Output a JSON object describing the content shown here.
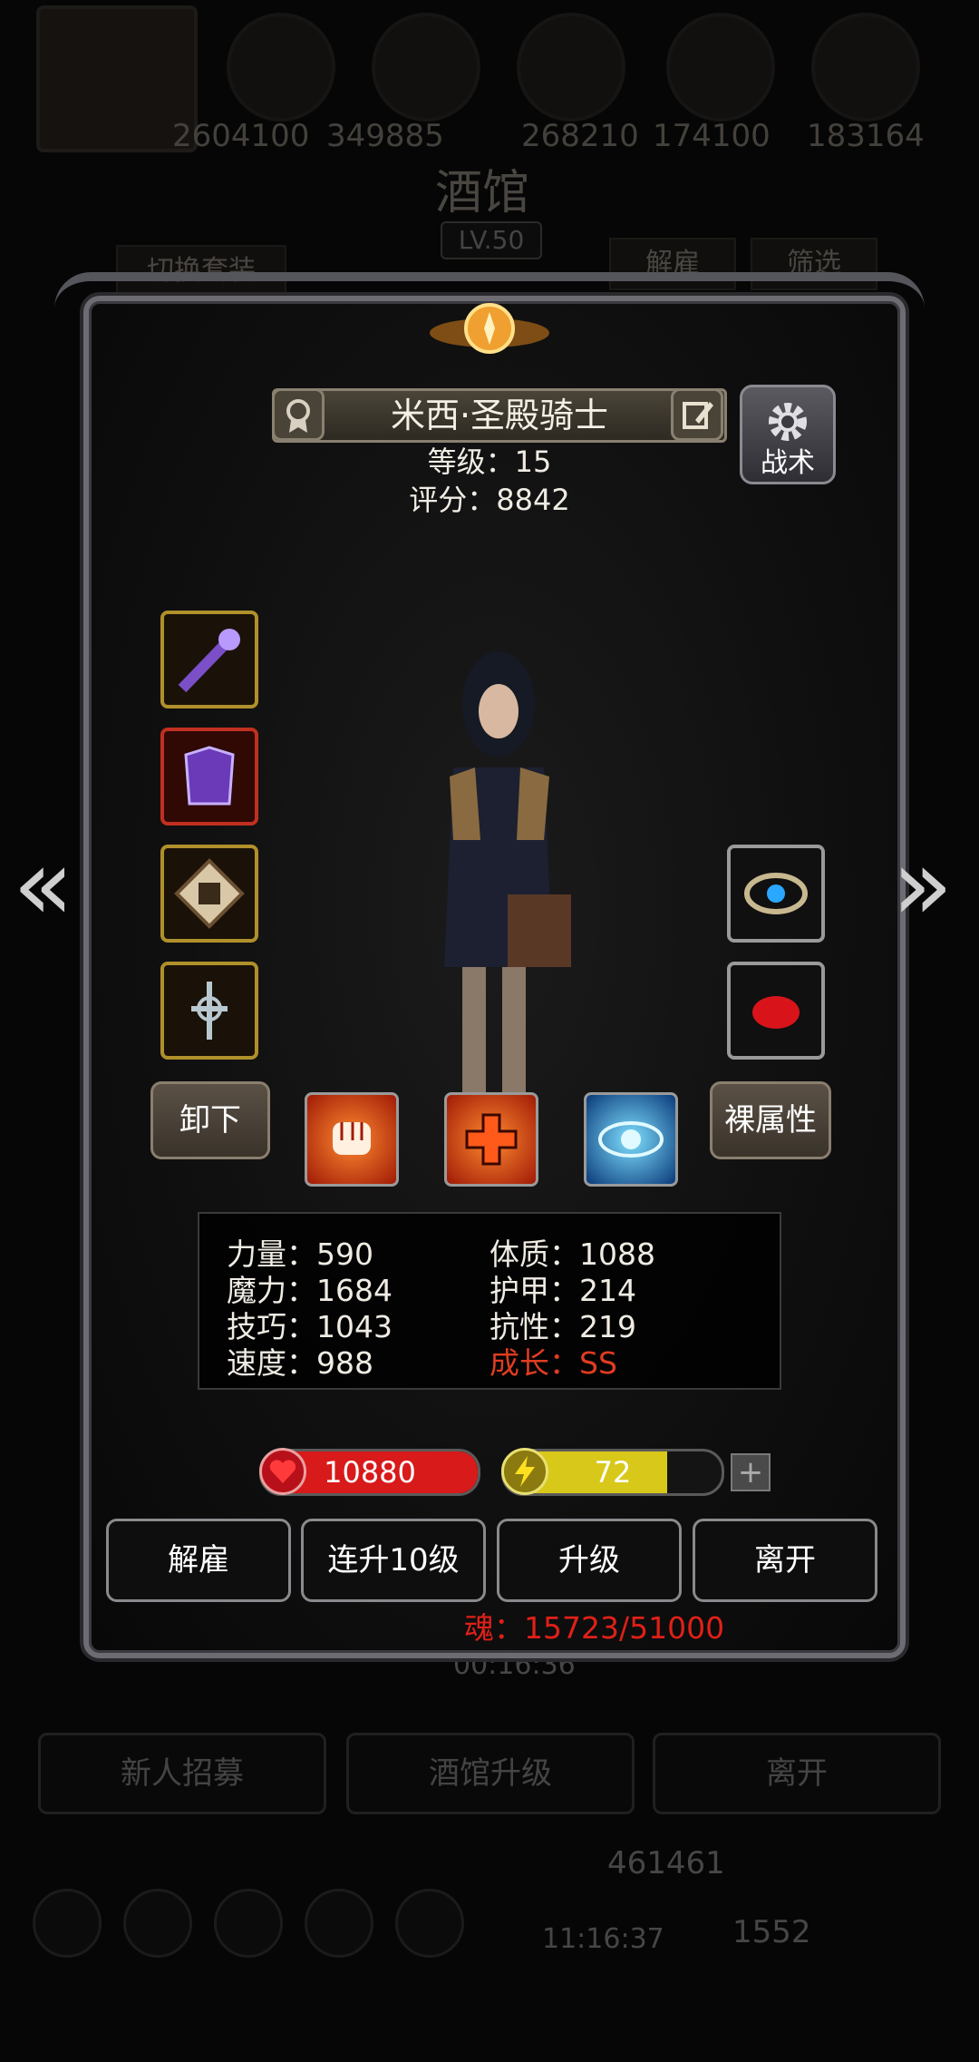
{
  "background": {
    "resources": [
      "2604100",
      "349885",
      "268210",
      "174100",
      "183164"
    ],
    "title": "酒馆",
    "level": "LV.50",
    "switch_outfit_label": "切换套装",
    "dismiss_label": "解雇",
    "filter_label": "筛选",
    "timer": "00:16:36",
    "bottom_buttons": [
      "新人招募",
      "酒馆升级",
      "离开"
    ],
    "gold": "461461",
    "gems": "1552",
    "clock": "11:16:37"
  },
  "hero": {
    "name": "米西·圣殿骑士",
    "level_line": "等级：15",
    "score_line": "评分：8842",
    "tactics_label": "战术"
  },
  "buttons": {
    "unequip": "卸下",
    "bare_attributes": "裸属性"
  },
  "stats": {
    "strength": "力量：590",
    "magic": "魔力：1684",
    "skill": "技巧：1043",
    "speed": "速度：988",
    "constitution": "体质：1088",
    "armor": "护甲：214",
    "resistance": "抗性：219",
    "growth": "成长：SS"
  },
  "bars": {
    "hp": "10880",
    "energy": "72",
    "energy_fraction": 0.75,
    "hp_color": "#d81a1a",
    "energy_color": "#d8c81a"
  },
  "actions": [
    "解雇",
    "连升10级",
    "升级",
    "离开"
  ],
  "soul": "魂：15723/51000",
  "icons": {
    "slots_left": [
      "staff-icon",
      "armor-icon",
      "tome-icon",
      "amulet-icon"
    ],
    "slots_right": [
      "ring-icon",
      "gem-icon"
    ],
    "skills": [
      "fist-icon",
      "heal-cross-icon",
      "eye-icon"
    ]
  }
}
